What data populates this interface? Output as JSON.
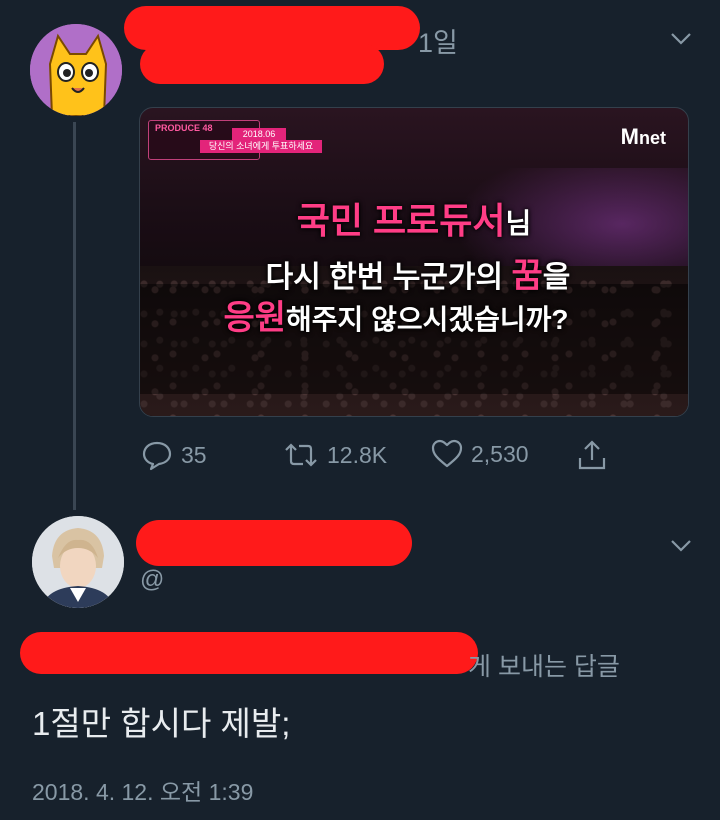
{
  "tweet": {
    "time_suffix": "1일",
    "media": {
      "badge_logo": "PRODUCE 48",
      "badge_date": "2018.06",
      "badge_sub": "당신의 소녀에게 투표하세요",
      "channel": "net",
      "channel_m": "M",
      "caption_1_pink": "국민 프로듀서",
      "caption_1_white": "님",
      "caption_2_a": "다시 한번 누군가의 ",
      "caption_2_pink": "꿈",
      "caption_2_b": "을",
      "caption_3_pink": "응원",
      "caption_3_b": "해주지 않으시겠습니까?"
    },
    "actions": {
      "replies": "35",
      "retweets": "12.8K",
      "likes": "2,530"
    }
  },
  "reply": {
    "handle_prefix": "@",
    "reply_to_suffix": "게 보내는 답글",
    "text": "1절만 합시다 제발;",
    "timestamp": "2018. 4. 12. 오전 1:39"
  },
  "colors": {
    "background": "#17212c",
    "muted_text": "#8899a6",
    "redaction": "#ff1a1a",
    "accent_pink": "#ff3d86"
  },
  "icons": [
    "chevron-down-icon",
    "reply-icon",
    "retweet-icon",
    "like-icon",
    "share-icon"
  ]
}
